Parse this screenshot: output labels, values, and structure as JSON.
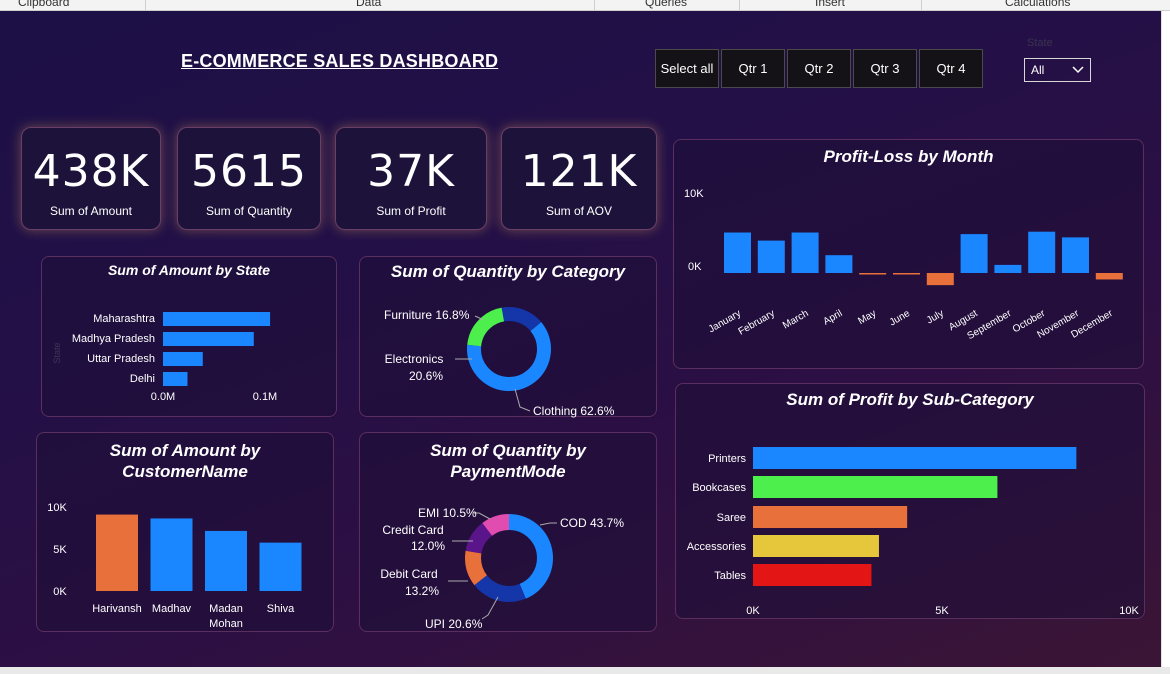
{
  "ribbon": {
    "items": [
      "Clipboard",
      "Data",
      "Queries",
      "Insert",
      "Calculations"
    ]
  },
  "dashboard": {
    "title": "E-COMMERCE SALES DASHBOARD"
  },
  "slicers": {
    "quarters": [
      "Select all",
      "Qtr 1",
      "Qtr 2",
      "Qtr 3",
      "Qtr 4"
    ],
    "state_label": "State",
    "state_value": "All"
  },
  "kpis": [
    {
      "value": "438K",
      "label": "Sum of Amount"
    },
    {
      "value": "5615",
      "label": "Sum of Quantity"
    },
    {
      "value": "37K",
      "label": "Sum of Profit"
    },
    {
      "value": "121K",
      "label": "Sum of AOV"
    }
  ],
  "colors": {
    "blue": "#1a86ff",
    "orange": "#e8703a",
    "green": "#4cef4c",
    "navy": "#1436a8",
    "purple": "#5a158a",
    "pink": "#e04cb0",
    "yellow": "#e6c63a",
    "red": "#e31515"
  },
  "chart_data": [
    {
      "id": "amount_by_state",
      "type": "bar",
      "orientation": "horizontal",
      "title": "Sum of Amount by State",
      "ylabel": "State",
      "categories": [
        "Maharashtra",
        "Madhya Pradesh",
        "Uttar Pradesh",
        "Delhi"
      ],
      "values": [
        0.105,
        0.089,
        0.039,
        0.024
      ],
      "xticks": [
        "0.0M",
        "0.1M"
      ],
      "xlim": [
        0,
        0.1
      ]
    },
    {
      "id": "quantity_by_category",
      "type": "pie",
      "donut": true,
      "title": "Sum of Quantity by Category",
      "labels": [
        "Clothing",
        "Electronics",
        "Furniture"
      ],
      "values": [
        62.6,
        20.6,
        16.8
      ],
      "display": [
        "Clothing 62.6%",
        "Electronics 20.6%",
        "Furniture 16.8%"
      ],
      "colors": [
        "#1a86ff",
        "#4cef4c",
        "#1436a8"
      ]
    },
    {
      "id": "profit_loss_by_month",
      "type": "bar",
      "title": "Profit-Loss by Month",
      "categories": [
        "January",
        "February",
        "March",
        "April",
        "May",
        "June",
        "July",
        "August",
        "September",
        "October",
        "November",
        "December"
      ],
      "values": [
        5000,
        4000,
        5000,
        2200,
        -100,
        -100,
        -1500,
        4800,
        1000,
        5100,
        4400,
        -800
      ],
      "yticks": [
        "10K",
        "0K"
      ],
      "ylim": [
        0,
        10000
      ],
      "colors": {
        "positive": "#1a86ff",
        "negative": "#e8703a"
      }
    },
    {
      "id": "amount_by_customer",
      "type": "bar",
      "title": "Sum of Amount by CustomerName",
      "categories": [
        "Harivansh",
        "Madhav",
        "Madan Mohan",
        "Shiva"
      ],
      "values": [
        9800,
        9300,
        7700,
        6200
      ],
      "yticks": [
        "10K",
        "5K",
        "0K"
      ],
      "ylim": [
        0,
        10000
      ],
      "bar_colors": [
        "#e8703a",
        "#1a86ff",
        "#1a86ff",
        "#1a86ff"
      ]
    },
    {
      "id": "quantity_by_paymentmode",
      "type": "pie",
      "donut": true,
      "title": "Sum of Quantity by PaymentMode",
      "labels": [
        "COD",
        "UPI",
        "Debit Card",
        "Credit Card",
        "EMI"
      ],
      "values": [
        43.7,
        20.6,
        13.2,
        12.0,
        10.5
      ],
      "display": [
        "COD 43.7%",
        "UPI 20.6%",
        "Debit Card 13.2%",
        "Credit Card 12.0%",
        "EMI 10.5%"
      ],
      "colors": [
        "#1a86ff",
        "#1436a8",
        "#e8703a",
        "#5a158a",
        "#e04cb0"
      ]
    },
    {
      "id": "profit_by_subcategory",
      "type": "bar",
      "orientation": "horizontal",
      "title": "Sum of Profit by Sub-Category",
      "categories": [
        "Printers",
        "Bookcases",
        "Saree",
        "Accessories",
        "Tables"
      ],
      "values": [
        8600,
        6500,
        4100,
        3350,
        3150
      ],
      "xticks": [
        "0K",
        "5K",
        "10K"
      ],
      "xlim": [
        0,
        10000
      ],
      "bar_colors": [
        "#1a86ff",
        "#4cef4c",
        "#e8703a",
        "#e6c63a",
        "#e31515"
      ]
    }
  ]
}
